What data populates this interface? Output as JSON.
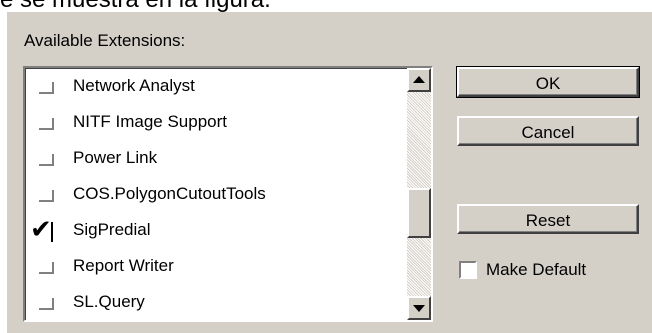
{
  "caption": "e se muestra en la figura.",
  "dialog": {
    "extensions_label": "Available Extensions:",
    "extensions": [
      {
        "label": "Network Analyst",
        "checked": false
      },
      {
        "label": "NITF Image Support",
        "checked": false
      },
      {
        "label": "Power Link",
        "checked": false
      },
      {
        "label": "COS.PolygonCutoutTools",
        "checked": false
      },
      {
        "label": "SigPredial",
        "checked": true
      },
      {
        "label": "Report Writer",
        "checked": false
      },
      {
        "label": "SL.Query",
        "checked": false
      }
    ],
    "buttons": {
      "ok": "OK",
      "cancel": "Cancel",
      "reset": "Reset"
    },
    "make_default": {
      "label": "Make Default",
      "checked": false
    }
  }
}
